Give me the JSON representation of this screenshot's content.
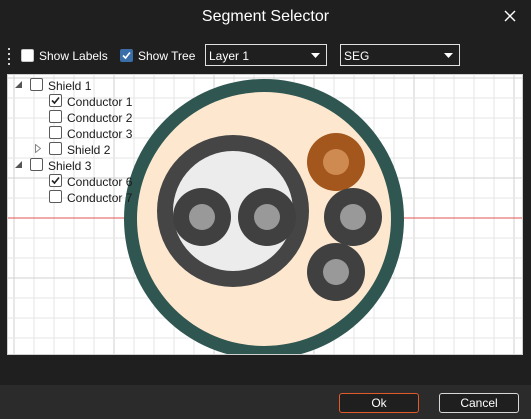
{
  "window": {
    "title": "Segment Selector",
    "close_icon": "close-icon"
  },
  "toolbar": {
    "show_labels": {
      "label": "Show Labels",
      "checked": false
    },
    "show_tree": {
      "label": "Show Tree",
      "checked": true
    },
    "layer_select": {
      "value": "Layer 1"
    },
    "type_select": {
      "value": "SEG"
    }
  },
  "tree": {
    "items": [
      {
        "label": "Shield 1",
        "checked": false,
        "expander": "expanded"
      },
      {
        "label": "Conductor 1",
        "checked": true
      },
      {
        "label": "Conductor 2",
        "checked": false
      },
      {
        "label": "Conductor 3",
        "checked": false
      },
      {
        "label": "Shield 2",
        "checked": false,
        "expander": "collapsed"
      },
      {
        "label": "Shield 3",
        "checked": false,
        "expander": "expanded"
      },
      {
        "label": "Conductor 6",
        "checked": true
      },
      {
        "label": "Conductor 7",
        "checked": false
      }
    ]
  },
  "canvas": {
    "colors": {
      "outer_jacket": "#2f5651",
      "filler": "#fde8cf",
      "shield_ring": "#454545",
      "shield_inner": "#ececec",
      "conductor_outer": "#404040",
      "conductor_core": "#999999",
      "highlight_outer": "#a3571c",
      "highlight_core": "#cf8a52",
      "axis_line": "#e05555"
    }
  },
  "buttons": {
    "ok": "Ok",
    "cancel": "Cancel"
  }
}
